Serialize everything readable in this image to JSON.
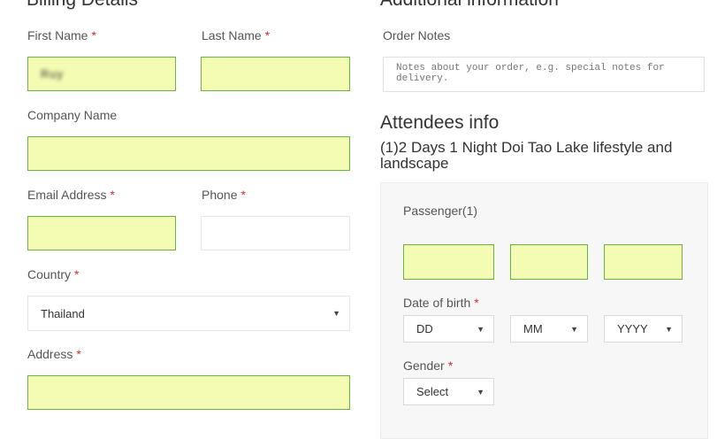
{
  "billing": {
    "title": "Billing Details",
    "first_name": {
      "label": "First Name",
      "required": "*",
      "value": "Ruy"
    },
    "last_name": {
      "label": "Last Name",
      "required": "*",
      "value": ""
    },
    "company_name": {
      "label": "Company Name",
      "value": ""
    },
    "email": {
      "label": "Email Address",
      "required": "*",
      "value": ""
    },
    "phone": {
      "label": "Phone",
      "required": "*",
      "value": ""
    },
    "country": {
      "label": "Country",
      "required": "*",
      "value": "Thailand"
    },
    "address": {
      "label": "Address",
      "required": "*",
      "value": ""
    }
  },
  "additional": {
    "title": "Additional information",
    "order_notes": {
      "label": "Order Notes",
      "placeholder": "Notes about your order, e.g. special notes for delivery."
    }
  },
  "attendees": {
    "title": "Attendees info",
    "trip_title": "(1)2 Days 1 Night Doi Tao Lake lifestyle and landscape",
    "passenger_label": "Passenger(1)",
    "fields": [
      "",
      "",
      ""
    ],
    "dob": {
      "label": "Date of birth",
      "required": "*",
      "day": "DD",
      "month": "MM",
      "year": "YYYY"
    },
    "gender": {
      "label": "Gender",
      "required": "*",
      "value": "Select"
    }
  },
  "icons": {
    "dropdown": "triangle-down-icon"
  },
  "colors": {
    "filled_bg": "#f4fbb3",
    "filled_border": "#67b442",
    "required": "#d32f2f"
  }
}
